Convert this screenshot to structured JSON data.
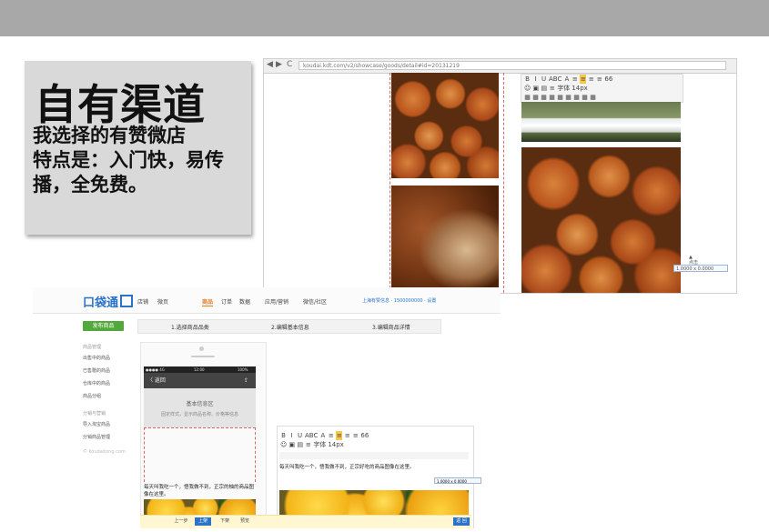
{
  "slide": {
    "title": "自有渠道",
    "body": "我选择的有赞微店\n特点是：入门快，易传播，全免费。"
  },
  "browser": {
    "back_glyph": "◀",
    "forward_glyph": "▶",
    "reload_glyph": "C",
    "url": "koudai.kdt.com/v2/showcase/goods/detail#id=20131219"
  },
  "editor": {
    "toolbar_row1": [
      "B",
      "I",
      "U",
      "ABC",
      "A",
      "≡",
      "≡",
      "≡",
      "≡",
      "66"
    ],
    "toolbar_row2": [
      "☺",
      "▣",
      "▤",
      "≡",
      "字体",
      "14px"
    ],
    "toolbar_row3": [
      "▦",
      "▦",
      "▦",
      "▦",
      "▦",
      "▦",
      "▦",
      "▦",
      "▦"
    ],
    "side_glyph_up": "▲",
    "side_label": "点击",
    "side_box": "1.0000 x 0.0000"
  },
  "app": {
    "logo": "口袋通",
    "nav": [
      "店铺",
      "微页",
      "商品",
      "订单",
      "数据",
      "应用/营销",
      "微信/社区"
    ],
    "nav_active_index": 2,
    "header_right": "上海有赞信息 · 1500000000 · 设置",
    "publish_button": "发布商品",
    "steps": [
      "1.选择商品品类",
      "2.编辑基本信息",
      "3.编辑商品详情"
    ],
    "side_groups": [
      {
        "title": "商品管理",
        "items": [
          "出售中的商品",
          "已售罄的商品",
          "仓库中的商品",
          "商品分组"
        ]
      },
      {
        "title": "分销与营销",
        "items": [
          "导入淘宝商品",
          "分销商品管理"
        ]
      }
    ],
    "side_footer": "© koudaitong.com",
    "phone": {
      "status_left": "●●●● 4G",
      "status_time": "12:00",
      "status_right": "100%",
      "back_label": "〈 返回",
      "share_glyph": "⇪",
      "info_title": "基本信息区",
      "info_sub": "固定样式，显示商品名称、价格等信息",
      "desc": "每天叫我吃一个，悟我做不到，正宗的柚的商品图像在这里。"
    },
    "edit_panel": {
      "row1": [
        "B",
        "I",
        "U",
        "ABC",
        "A",
        "≡",
        "≡",
        "≡",
        "≡",
        "66"
      ],
      "row2": [
        "☺",
        "▣",
        "▤",
        "≡",
        "字体",
        "14px"
      ],
      "text": "每天叫我吃一个，悟我做不到，正宗好吃的商品图像在这里。",
      "size_label": "1.0000 x 0.0000"
    },
    "footer": {
      "prev": "上一步",
      "save": "上架",
      "next": "下架",
      "preview": "预览",
      "corner": "返 回"
    }
  },
  "colors": {
    "topbar": "#a8a8a8",
    "callout_bg": "#d9d9d9",
    "brand_blue": "#2a73c8",
    "active_orange": "#e57b1f",
    "publish_green": "#53a83b"
  }
}
